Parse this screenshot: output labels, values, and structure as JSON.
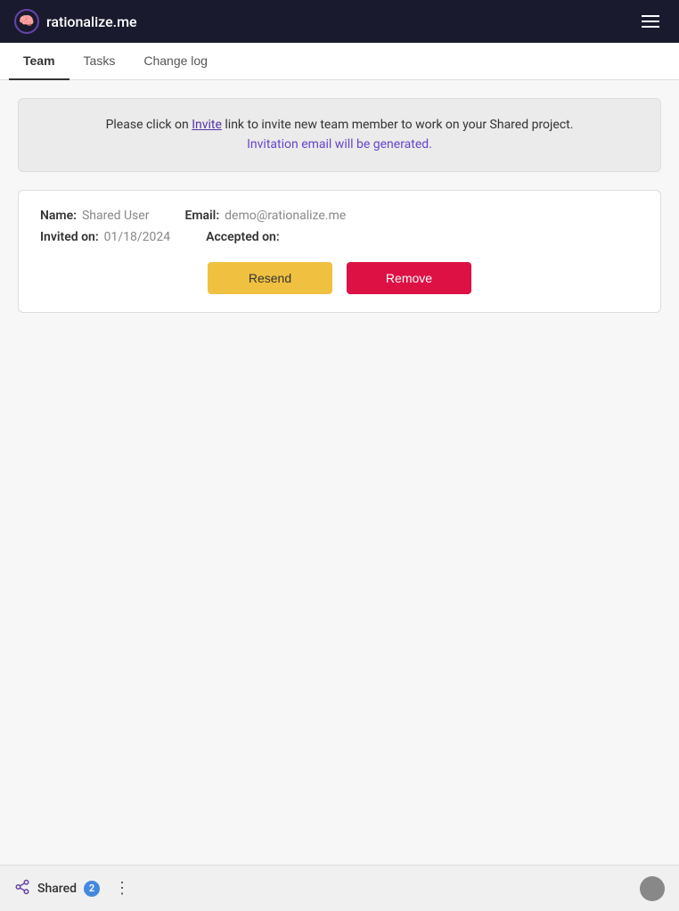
{
  "header": {
    "logo_text": "rationalize.me",
    "logo_icon": "🧠",
    "menu_label": "Menu"
  },
  "tabs": [
    {
      "id": "team",
      "label": "Team",
      "active": true
    },
    {
      "id": "tasks",
      "label": "Tasks",
      "active": false
    },
    {
      "id": "changelog",
      "label": "Change log",
      "active": false
    }
  ],
  "info_banner": {
    "line1_prefix": "Please click on ",
    "invite_link_text": "Invite",
    "line1_suffix": " link to invite new team member to work on your Shared project.",
    "line2": "Invitation email will be generated."
  },
  "member_card": {
    "name_label": "Name:",
    "name_value": "Shared User",
    "email_label": "Email:",
    "email_value": "demo@rationalize.me",
    "invited_on_label": "Invited on:",
    "invited_on_value": "01/18/2024",
    "accepted_on_label": "Accepted on:",
    "accepted_on_value": "",
    "resend_button_label": "Resend",
    "remove_button_label": "Remove"
  },
  "footer": {
    "share_icon": "⬡",
    "project_name": "Shared",
    "member_count": "2",
    "menu_dots": "⋮"
  }
}
